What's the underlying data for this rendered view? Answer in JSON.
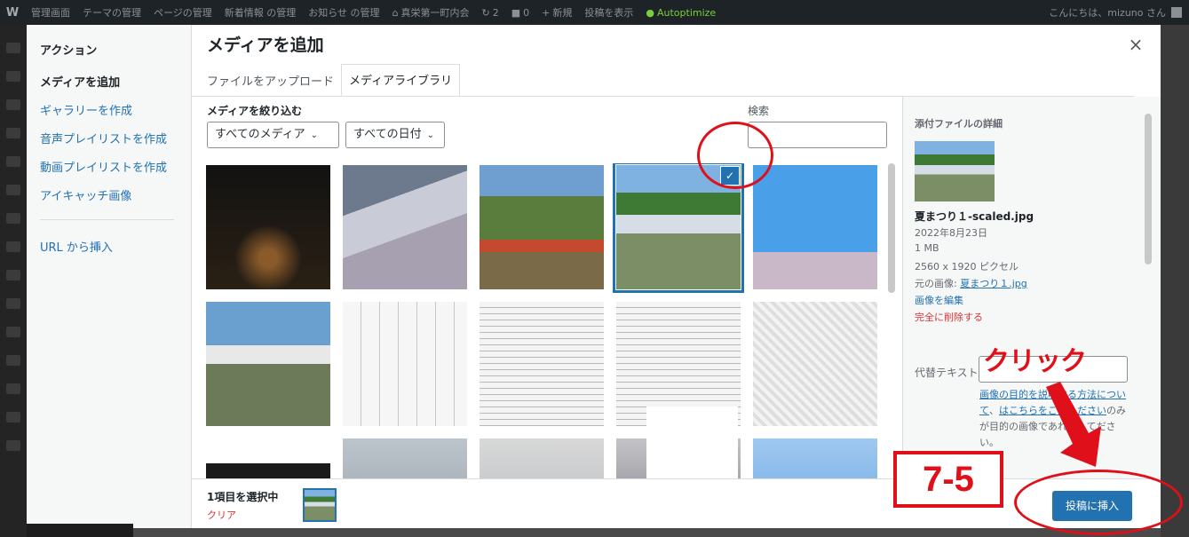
{
  "admin_bar": {
    "items": [
      "管理画面",
      "テーマの管理",
      "ページの管理",
      "新着情報 の管理",
      "お知らせ の管理",
      "真栄第一町内会",
      "2",
      "0",
      "新規",
      "投稿を表示",
      "Autoptimize"
    ],
    "greeting": "こんにちは、mizuno さん"
  },
  "modal": {
    "title": "メディアを追加",
    "close_label": "×",
    "menu": {
      "heading": "アクション",
      "items": [
        "メディアを追加",
        "ギャラリーを作成",
        "音声プレイリストを作成",
        "動画プレイリストを作成",
        "アイキャッチ画像",
        "URL から挿入"
      ]
    },
    "tabs": [
      "ファイルをアップロード",
      "メディアライブラリ"
    ],
    "filter": {
      "label": "メディアを絞り込む",
      "type_value": "すべてのメディア",
      "date_value": "すべての日付"
    },
    "search": {
      "label": "検索",
      "value": ""
    },
    "selected_index": 3,
    "details": {
      "heading": "添付ファイルの詳細",
      "filename": "夏まつり１-scaled.jpg",
      "date": "2022年8月23日",
      "size": "1 MB",
      "dimensions": "2560 x 1920 ピクセル",
      "original_prefix": "元の画像:",
      "original_name": "夏まつり１.jpg",
      "edit_link": "画像を編集",
      "delete_link": "完全に削除する",
      "alt_label": "代替テキスト",
      "alt_value": "",
      "help_link": "画像の目的を説明する方法について",
      "help_mid": "、",
      "help_link2": "はこちらをご覧ください",
      "help_tail": "のみが目的の画像であれ",
      "help_tail2": "にして",
      "help_tail3": "ださい。"
    },
    "toolbar": {
      "selected_text": "1項目を選択中",
      "clear_label": "クリア",
      "insert_label": "投稿に挿入"
    }
  },
  "annotations": {
    "step_label": "7-5",
    "click_label": "クリック",
    "color": "#e0101a"
  },
  "theme": {
    "accent": "#2271b1",
    "danger": "#d63638"
  }
}
